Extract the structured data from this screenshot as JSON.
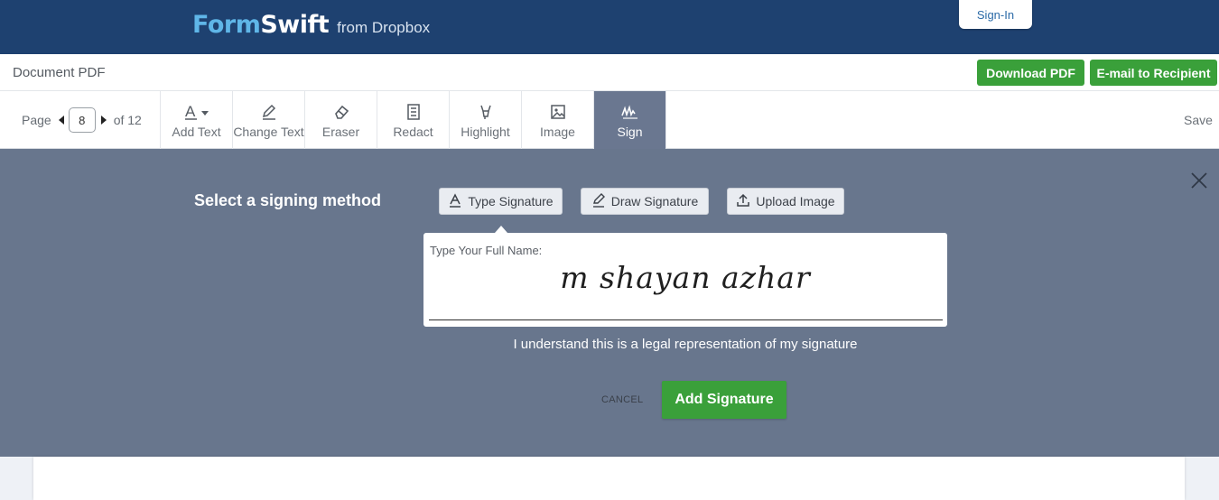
{
  "header": {
    "logo_part1": "Form",
    "logo_part2": "Swift",
    "logo_sub": "from Dropbox",
    "signin_label": "Sign-In",
    "colors": {
      "background": "#1e4170",
      "logo_accent": "#5fb6e8"
    }
  },
  "docbar": {
    "title": "Document PDF",
    "download_label": "Download PDF",
    "email_label": "E-mail to Recipient",
    "button_color": "#3aa03a"
  },
  "toolbar": {
    "page_label": "Page",
    "current_page": "8",
    "total_label": "of 12",
    "tools": [
      {
        "label": "Add Text",
        "icon": "text-a-icon"
      },
      {
        "label": "Change Text",
        "icon": "pen-edit-icon"
      },
      {
        "label": "Eraser",
        "icon": "eraser-icon"
      },
      {
        "label": "Redact",
        "icon": "document-lines-icon"
      },
      {
        "label": "Highlight",
        "icon": "highlighter-icon"
      },
      {
        "label": "Image",
        "icon": "image-icon"
      },
      {
        "label": "Sign",
        "icon": "signature-icon"
      }
    ],
    "active_tool": "Sign",
    "save_label": "Save"
  },
  "sign_panel": {
    "heading": "Select a signing method",
    "methods": [
      {
        "label": "Type Signature",
        "icon": "type-a-icon"
      },
      {
        "label": "Draw Signature",
        "icon": "pen-icon"
      },
      {
        "label": "Upload Image",
        "icon": "upload-icon"
      }
    ],
    "selected_method": "Type Signature",
    "field_label": "Type Your Full Name:",
    "signature_value": "m shayan azhar",
    "legal_text": "I understand this is a legal representation of my signature",
    "cancel_label": "CANCEL",
    "add_label": "Add Signature",
    "panel_color": "#68768d"
  }
}
